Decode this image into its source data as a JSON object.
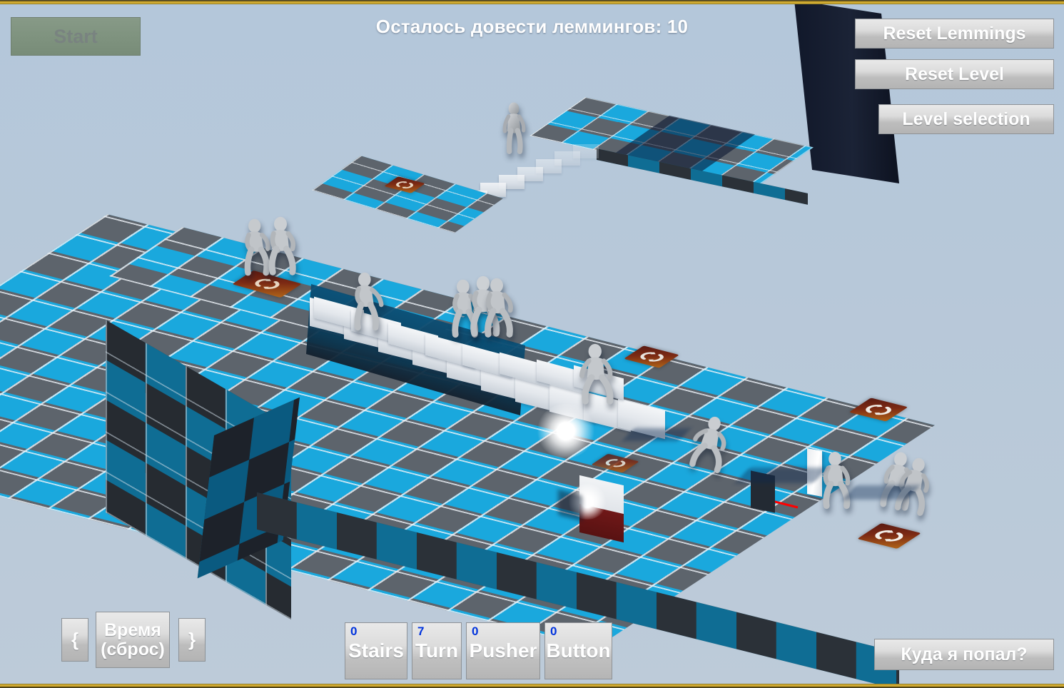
{
  "window": {
    "accent_gold": "#c9a227",
    "sky_color": "#b7c8d9"
  },
  "hud": {
    "start_label": "Start",
    "objective_label": "Осталось довести леммингов: 10",
    "lemmings_remaining": 10,
    "reset_lemmings_label": "Reset Lemmings",
    "reset_level_label": "Reset Level",
    "level_selection_label": "Level selection",
    "where_am_i_label": "Куда я попал?"
  },
  "time_controls": {
    "prev_label": "{",
    "reset_line1": "Время",
    "reset_line2": "(сброс)",
    "next_label": "}"
  },
  "abilities": [
    {
      "name": "stairs",
      "label": "Stairs",
      "count": "0"
    },
    {
      "name": "turn",
      "label": "Turn",
      "count": "7"
    },
    {
      "name": "pusher",
      "label": "Pusher",
      "count": "0"
    },
    {
      "name": "button",
      "label": "Button",
      "count": "0"
    }
  ],
  "scene": {
    "tile_color_cyan": "#1aa8dd",
    "tile_color_gray": "#5d646c",
    "tile_edge_color": "#eaf0f5",
    "turn_marker_color": "#7c2a14",
    "pillar_color": "#151c2b",
    "stair_color": "#eef1f4",
    "lemming_color": "#b9bcc0",
    "lemming_count_visible": 14,
    "turn_markers_visible": 5,
    "pusher_arrow_color": "#ff0000"
  }
}
